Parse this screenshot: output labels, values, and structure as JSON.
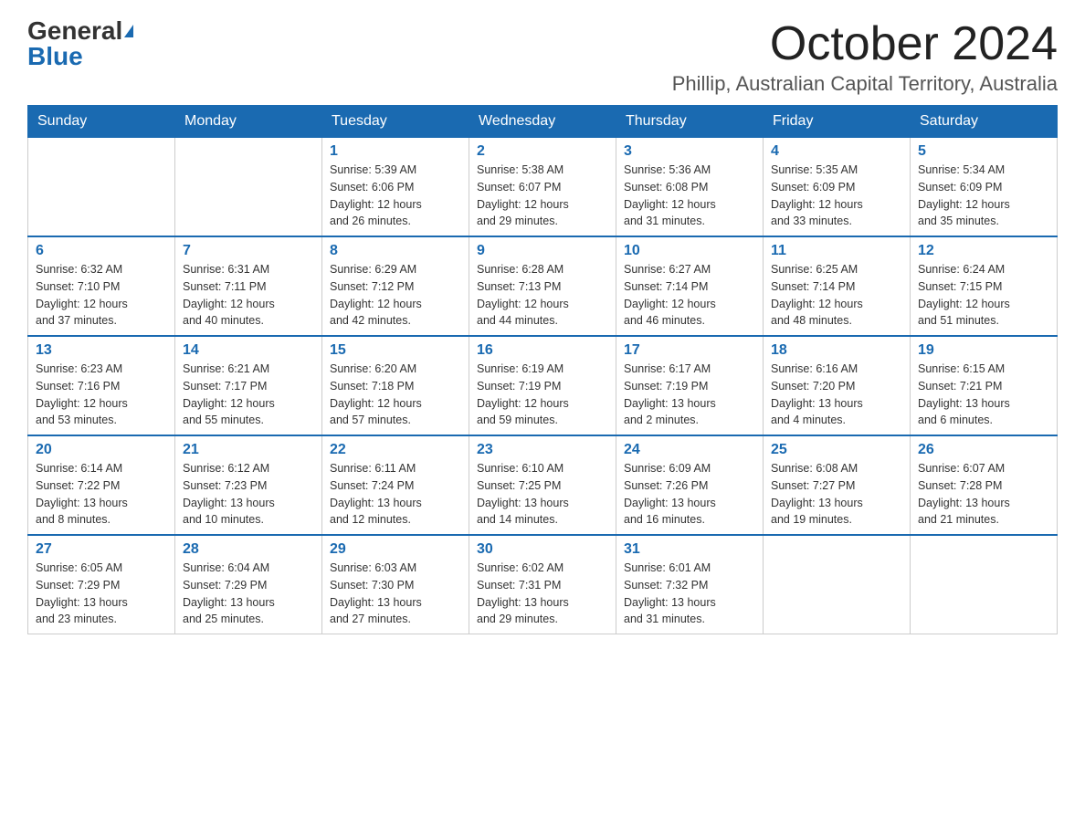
{
  "logo": {
    "general": "General",
    "blue": "Blue"
  },
  "title": "October 2024",
  "location": "Phillip, Australian Capital Territory, Australia",
  "days_of_week": [
    "Sunday",
    "Monday",
    "Tuesday",
    "Wednesday",
    "Thursday",
    "Friday",
    "Saturday"
  ],
  "weeks": [
    [
      {
        "day": "",
        "info": ""
      },
      {
        "day": "",
        "info": ""
      },
      {
        "day": "1",
        "info": "Sunrise: 5:39 AM\nSunset: 6:06 PM\nDaylight: 12 hours\nand 26 minutes."
      },
      {
        "day": "2",
        "info": "Sunrise: 5:38 AM\nSunset: 6:07 PM\nDaylight: 12 hours\nand 29 minutes."
      },
      {
        "day": "3",
        "info": "Sunrise: 5:36 AM\nSunset: 6:08 PM\nDaylight: 12 hours\nand 31 minutes."
      },
      {
        "day": "4",
        "info": "Sunrise: 5:35 AM\nSunset: 6:09 PM\nDaylight: 12 hours\nand 33 minutes."
      },
      {
        "day": "5",
        "info": "Sunrise: 5:34 AM\nSunset: 6:09 PM\nDaylight: 12 hours\nand 35 minutes."
      }
    ],
    [
      {
        "day": "6",
        "info": "Sunrise: 6:32 AM\nSunset: 7:10 PM\nDaylight: 12 hours\nand 37 minutes."
      },
      {
        "day": "7",
        "info": "Sunrise: 6:31 AM\nSunset: 7:11 PM\nDaylight: 12 hours\nand 40 minutes."
      },
      {
        "day": "8",
        "info": "Sunrise: 6:29 AM\nSunset: 7:12 PM\nDaylight: 12 hours\nand 42 minutes."
      },
      {
        "day": "9",
        "info": "Sunrise: 6:28 AM\nSunset: 7:13 PM\nDaylight: 12 hours\nand 44 minutes."
      },
      {
        "day": "10",
        "info": "Sunrise: 6:27 AM\nSunset: 7:14 PM\nDaylight: 12 hours\nand 46 minutes."
      },
      {
        "day": "11",
        "info": "Sunrise: 6:25 AM\nSunset: 7:14 PM\nDaylight: 12 hours\nand 48 minutes."
      },
      {
        "day": "12",
        "info": "Sunrise: 6:24 AM\nSunset: 7:15 PM\nDaylight: 12 hours\nand 51 minutes."
      }
    ],
    [
      {
        "day": "13",
        "info": "Sunrise: 6:23 AM\nSunset: 7:16 PM\nDaylight: 12 hours\nand 53 minutes."
      },
      {
        "day": "14",
        "info": "Sunrise: 6:21 AM\nSunset: 7:17 PM\nDaylight: 12 hours\nand 55 minutes."
      },
      {
        "day": "15",
        "info": "Sunrise: 6:20 AM\nSunset: 7:18 PM\nDaylight: 12 hours\nand 57 minutes."
      },
      {
        "day": "16",
        "info": "Sunrise: 6:19 AM\nSunset: 7:19 PM\nDaylight: 12 hours\nand 59 minutes."
      },
      {
        "day": "17",
        "info": "Sunrise: 6:17 AM\nSunset: 7:19 PM\nDaylight: 13 hours\nand 2 minutes."
      },
      {
        "day": "18",
        "info": "Sunrise: 6:16 AM\nSunset: 7:20 PM\nDaylight: 13 hours\nand 4 minutes."
      },
      {
        "day": "19",
        "info": "Sunrise: 6:15 AM\nSunset: 7:21 PM\nDaylight: 13 hours\nand 6 minutes."
      }
    ],
    [
      {
        "day": "20",
        "info": "Sunrise: 6:14 AM\nSunset: 7:22 PM\nDaylight: 13 hours\nand 8 minutes."
      },
      {
        "day": "21",
        "info": "Sunrise: 6:12 AM\nSunset: 7:23 PM\nDaylight: 13 hours\nand 10 minutes."
      },
      {
        "day": "22",
        "info": "Sunrise: 6:11 AM\nSunset: 7:24 PM\nDaylight: 13 hours\nand 12 minutes."
      },
      {
        "day": "23",
        "info": "Sunrise: 6:10 AM\nSunset: 7:25 PM\nDaylight: 13 hours\nand 14 minutes."
      },
      {
        "day": "24",
        "info": "Sunrise: 6:09 AM\nSunset: 7:26 PM\nDaylight: 13 hours\nand 16 minutes."
      },
      {
        "day": "25",
        "info": "Sunrise: 6:08 AM\nSunset: 7:27 PM\nDaylight: 13 hours\nand 19 minutes."
      },
      {
        "day": "26",
        "info": "Sunrise: 6:07 AM\nSunset: 7:28 PM\nDaylight: 13 hours\nand 21 minutes."
      }
    ],
    [
      {
        "day": "27",
        "info": "Sunrise: 6:05 AM\nSunset: 7:29 PM\nDaylight: 13 hours\nand 23 minutes."
      },
      {
        "day": "28",
        "info": "Sunrise: 6:04 AM\nSunset: 7:29 PM\nDaylight: 13 hours\nand 25 minutes."
      },
      {
        "day": "29",
        "info": "Sunrise: 6:03 AM\nSunset: 7:30 PM\nDaylight: 13 hours\nand 27 minutes."
      },
      {
        "day": "30",
        "info": "Sunrise: 6:02 AM\nSunset: 7:31 PM\nDaylight: 13 hours\nand 29 minutes."
      },
      {
        "day": "31",
        "info": "Sunrise: 6:01 AM\nSunset: 7:32 PM\nDaylight: 13 hours\nand 31 minutes."
      },
      {
        "day": "",
        "info": ""
      },
      {
        "day": "",
        "info": ""
      }
    ]
  ]
}
